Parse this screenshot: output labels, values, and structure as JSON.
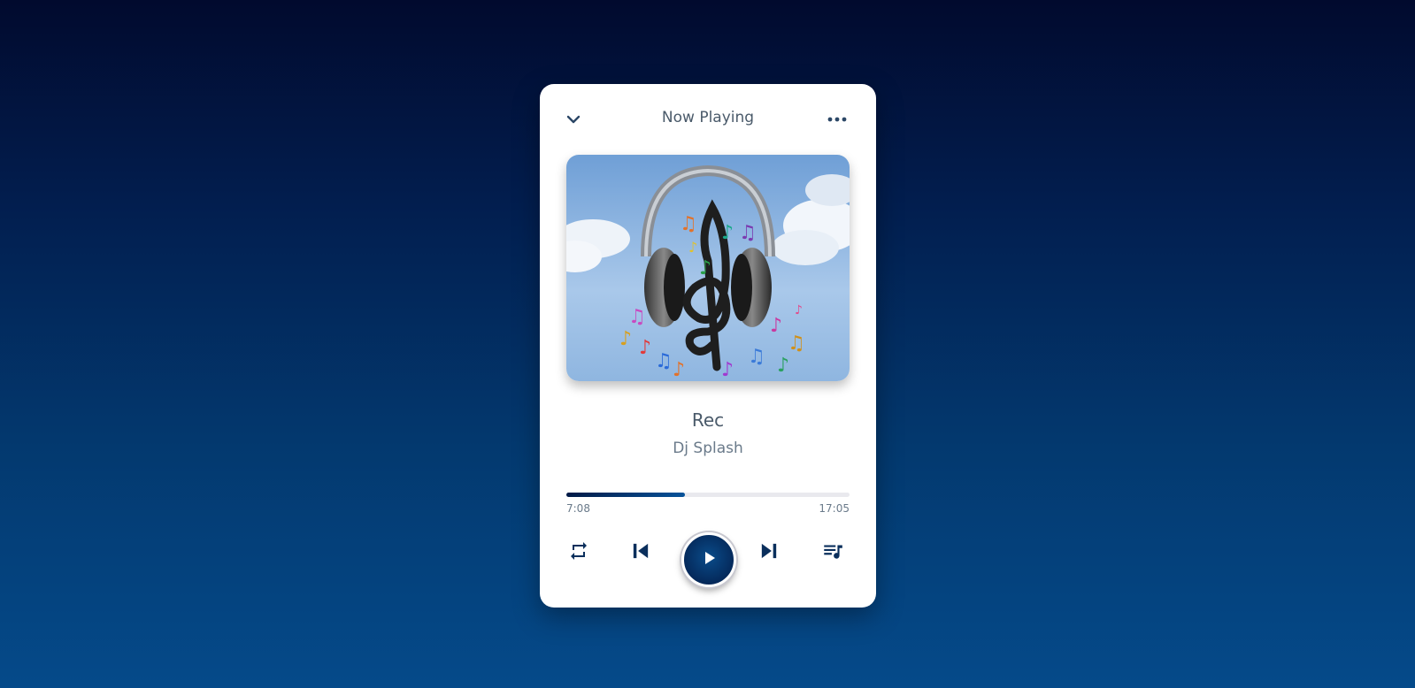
{
  "header": {
    "title": "Now Playing",
    "collapse_icon": "chevron-down-icon",
    "menu_icon": "more-horizontal-icon"
  },
  "track": {
    "title": "Rec",
    "artist": "Dj Splash",
    "artwork_icon": "headphones-music-notes-artwork"
  },
  "progress": {
    "current_time": "7:08",
    "total_time": "17:05",
    "fraction": 0.42
  },
  "controls": {
    "repeat_icon": "repeat-icon",
    "previous_icon": "skip-previous-icon",
    "play_icon": "play-icon",
    "next_icon": "skip-next-icon",
    "queue_icon": "queue-music-icon"
  },
  "colors": {
    "accent": "#022a5e",
    "background_top": "#010a2e",
    "background_bottom": "#054a8a",
    "text": "#4a5a6a"
  }
}
